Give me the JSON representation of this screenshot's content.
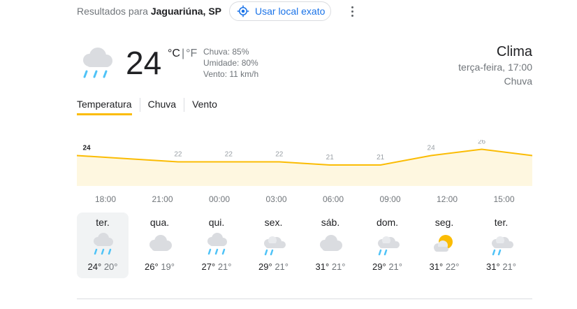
{
  "header": {
    "results_prefix": "Resultados para",
    "location": "Jaguariúna, SP",
    "use_location_label": "Usar local exato"
  },
  "current": {
    "temperature": "24",
    "unit_c": "°C",
    "unit_sep": "|",
    "unit_f": "°F",
    "precipitation": "Chuva: 85%",
    "humidity": "Umidade: 80%",
    "wind": "Vento: 11 km/h",
    "icon": "rain-cloud-icon"
  },
  "summary": {
    "title": "Clima",
    "datetime": "terça-feira, 17:00",
    "condition": "Chuva"
  },
  "tabs": [
    {
      "label": "Temperatura",
      "active": true
    },
    {
      "label": "Chuva",
      "active": false
    },
    {
      "label": "Vento",
      "active": false
    }
  ],
  "chart_data": {
    "type": "area",
    "x": [
      "17:00",
      "18:00",
      "21:00",
      "00:00",
      "03:00",
      "06:00",
      "09:00",
      "12:00",
      "15:00",
      "18:00"
    ],
    "values": [
      24,
      23,
      22,
      22,
      22,
      21,
      21,
      24,
      26,
      24
    ],
    "labels": [
      "24",
      "",
      "22",
      "22",
      "22",
      "21",
      "21",
      "24",
      "26",
      ""
    ],
    "time_labels": [
      "18:00",
      "21:00",
      "00:00",
      "03:00",
      "06:00",
      "09:00",
      "12:00",
      "15:00"
    ],
    "color": "#fbbc04",
    "fill": "#fef7e0"
  },
  "forecast": [
    {
      "day": "ter.",
      "icon": "rain-cloud-icon",
      "hi": "24°",
      "lo": "20°",
      "selected": true
    },
    {
      "day": "qua.",
      "icon": "cloud-icon",
      "hi": "26°",
      "lo": "19°",
      "selected": false
    },
    {
      "day": "qui.",
      "icon": "rain-cloud-icon",
      "hi": "27°",
      "lo": "21°",
      "selected": false
    },
    {
      "day": "sex.",
      "icon": "scattered-showers-icon",
      "hi": "29°",
      "lo": "21°",
      "selected": false
    },
    {
      "day": "sáb.",
      "icon": "cloud-icon",
      "hi": "31°",
      "lo": "21°",
      "selected": false
    },
    {
      "day": "dom.",
      "icon": "scattered-showers-icon",
      "hi": "29°",
      "lo": "21°",
      "selected": false
    },
    {
      "day": "seg.",
      "icon": "partly-cloudy-icon",
      "hi": "31°",
      "lo": "22°",
      "selected": false
    },
    {
      "day": "ter.",
      "icon": "scattered-showers-icon",
      "hi": "31°",
      "lo": "21°",
      "selected": false
    }
  ]
}
